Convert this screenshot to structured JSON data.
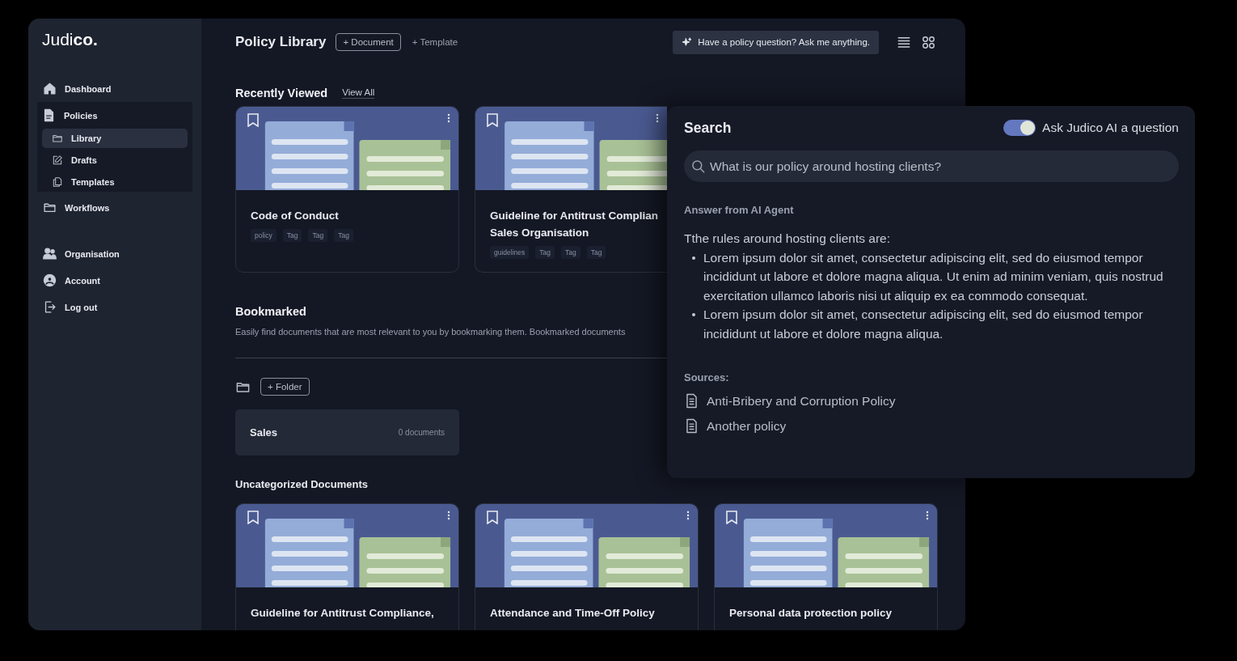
{
  "sidebar": {
    "logo": "Judi**co.**",
    "items": [
      {
        "label": "Dashboard",
        "selected": false
      },
      {
        "label": "Policies",
        "selected": false,
        "expanded": true,
        "children": [
          {
            "label": "Library",
            "selected": true
          },
          {
            "label": "Drafts",
            "selected": false
          },
          {
            "label": "Templates",
            "selected": false
          }
        ]
      },
      {
        "label": "Workflows",
        "selected": false
      },
      {
        "label": "Organisation",
        "selected": false
      },
      {
        "label": "Account",
        "selected": false
      },
      {
        "label": "Log out",
        "selected": false
      }
    ]
  },
  "header": {
    "title": "Policy Library",
    "buttons": [
      {
        "label": "+ Document",
        "kind": "outlined"
      },
      {
        "label": "+ Template",
        "kind": "plain"
      }
    ],
    "ask_button": "Have a policy question? Ask me anything."
  },
  "recently_viewed": {
    "title": "Recently Viewed",
    "link": "View All",
    "cards": [
      {
        "title": "Code of Conduct",
        "tags": [
          "policy",
          "Tag",
          "Tag",
          "Tag"
        ]
      },
      {
        "title": "Guideline for Antitrust Complian\nSales Organisation",
        "tags": [
          "guidelines",
          "Tag",
          "Tag",
          "Tag"
        ]
      }
    ]
  },
  "bookmarked": {
    "title": "Bookmarked",
    "description": "Easily find documents that are most relevant to you by bookmarking them. Bookmarked documents"
  },
  "folders": {
    "button": "+ Folder",
    "items": [
      {
        "name": "Sales",
        "count": "0 documents"
      }
    ]
  },
  "uncategorized": {
    "title": "Uncategorized Documents",
    "cards": [
      {
        "title": "Guideline for Antitrust Compliance,"
      },
      {
        "title": "Attendance and Time-Off Policy"
      },
      {
        "title": "Personal data protection policy"
      }
    ]
  },
  "search_panel": {
    "title": "Search",
    "toggle": {
      "label": "Ask Judico AI a question",
      "on": true
    },
    "query": "What is our policy around hosting clients?",
    "answer_label": "Answer from AI Agent",
    "answer_intro": "Tthe rules around hosting clients are:",
    "answer_points": [
      "Lorem ipsum dolor sit amet, consectetur adipiscing elit, sed do eiusmod tempor incididunt ut labore et dolore magna aliqua. Ut enim ad minim veniam, quis nostrud exercitation ullamco laboris nisi ut aliquip ex ea commodo consequat.",
      "Lorem ipsum dolor sit amet, consectetur adipiscing elit, sed do eiusmod tempor incididunt ut labore et dolore magna aliqua."
    ],
    "sources_label": "Sources:",
    "sources": [
      "Anti-Bribery and Corruption Policy",
      "Another policy"
    ]
  }
}
